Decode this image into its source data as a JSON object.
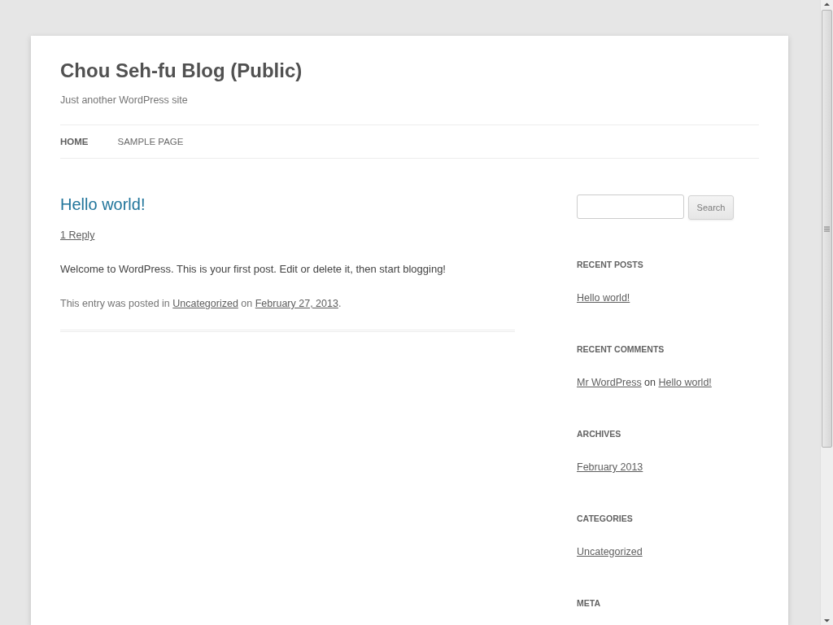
{
  "site": {
    "title": "Chou Seh-fu Blog (Public)",
    "tagline": "Just another WordPress site"
  },
  "nav": [
    {
      "label": "HOME",
      "selected": true
    },
    {
      "label": "SAMPLE PAGE",
      "selected": false
    }
  ],
  "post": {
    "title": "Hello world!",
    "reply_link": "1 Reply",
    "body": "Welcome to WordPress. This is your first post. Edit or delete it, then start blogging!",
    "meta": [
      {
        "kind": "text",
        "text": "This entry was posted in "
      },
      {
        "kind": "link",
        "text": "Uncategorized"
      },
      {
        "kind": "text",
        "text": " on "
      },
      {
        "kind": "link",
        "text": "February 27, 2013"
      },
      {
        "kind": "text",
        "text": "."
      }
    ]
  },
  "sidebar": {
    "search": {
      "button": "Search"
    },
    "widgets": [
      {
        "title": "RECENT POSTS",
        "items": [
          [
            {
              "kind": "link",
              "text": "Hello world!"
            }
          ]
        ]
      },
      {
        "title": "RECENT COMMENTS",
        "items": [
          [
            {
              "kind": "link",
              "text": "Mr WordPress"
            },
            {
              "kind": "text",
              "text": " on "
            },
            {
              "kind": "link",
              "text": "Hello world!"
            }
          ]
        ]
      },
      {
        "title": "ARCHIVES",
        "items": [
          [
            {
              "kind": "link",
              "text": "February 2013"
            }
          ]
        ]
      },
      {
        "title": "CATEGORIES",
        "items": [
          [
            {
              "kind": "link",
              "text": "Uncategorized"
            }
          ]
        ]
      },
      {
        "title": "META"
      }
    ]
  }
}
